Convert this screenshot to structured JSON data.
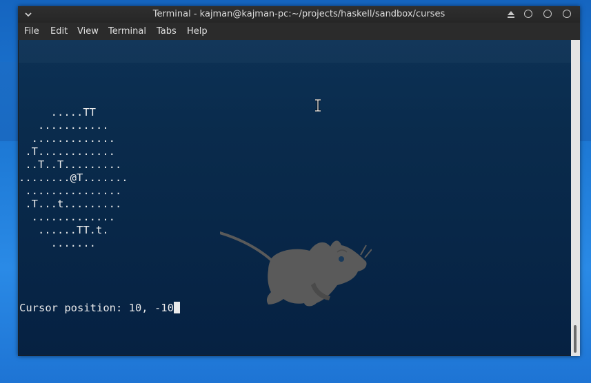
{
  "window": {
    "title": "Terminal - kajman@kajman-pc:~/projects/haskell/sandbox/curses",
    "menu_icon": "chevron-down-icon"
  },
  "menubar": {
    "items": [
      {
        "label": "File"
      },
      {
        "label": "Edit"
      },
      {
        "label": "View"
      },
      {
        "label": "Terminal"
      },
      {
        "label": "Tabs"
      },
      {
        "label": "Help"
      }
    ]
  },
  "terminal": {
    "map_rows": [
      "     .....TT",
      "   ...........",
      "  .............",
      " .T............",
      " ..T..T.........",
      "........@T.......",
      " ...............",
      " .T...t.........",
      "  .............",
      "   ......TT.t.",
      "     ......."
    ],
    "status_line": "Cursor position: 10, -10"
  },
  "colors": {
    "terminal_bg": "#0a2b4c",
    "text": "#eaeaea",
    "titlebar": "#2a2a2a",
    "desktop": "#1e7ad6"
  }
}
